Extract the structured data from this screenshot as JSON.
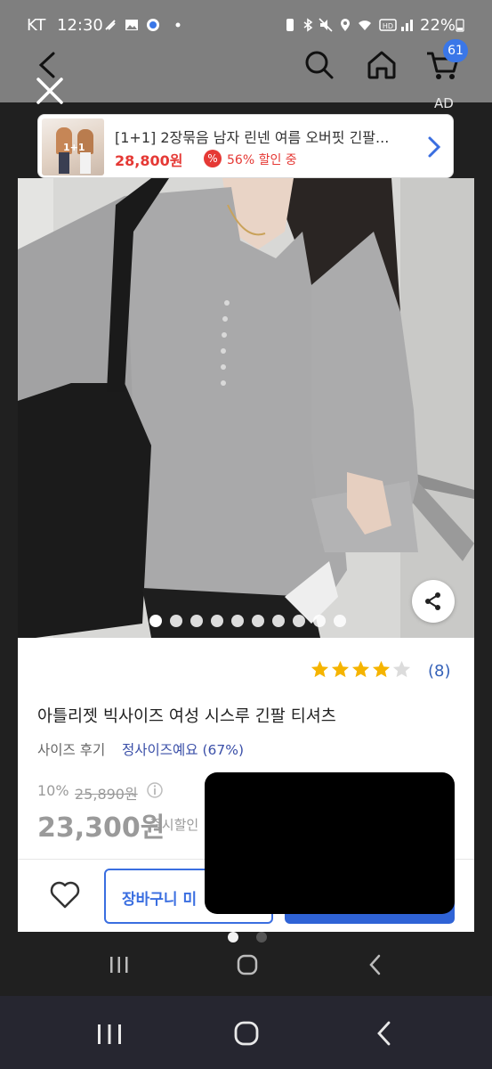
{
  "status_bar": {
    "carrier": "KT",
    "time": "12:30",
    "battery_percent": "22%"
  },
  "header": {
    "cart_count": "61",
    "ad_label": "AD"
  },
  "ad_banner": {
    "thumb_badge": "1+1",
    "title": "[1+1] 2장묶음 남자 린넨 여름 오버핏 긴팔...",
    "price": "28,800원",
    "sale_icon": "%",
    "discount": "56% 할인 중"
  },
  "product": {
    "rating": 4,
    "rating_max": 5,
    "review_count": "(8)",
    "title": "아틀리젯 빅사이즈 여성 시스루 긴팔 티셔츠",
    "size_review_label": "사이즈 후기",
    "size_review_value": "정사이즈예요 (67%)",
    "discount_rate": "10%",
    "original_price": "25,890원",
    "sale_price": "23,300원",
    "instant_discount_label": "즉시할인",
    "image_count": 10,
    "current_image_index": 0
  },
  "action_bar": {
    "add_to_cart_label": "장바구니 미"
  },
  "colors": {
    "accent": "#3a6ee0",
    "sale_red": "#e53935",
    "star_gold": "#f5b400",
    "link_blue": "#3461b8"
  },
  "icons": {
    "back": "chevron-left-icon",
    "search": "search-icon",
    "home": "home-icon",
    "cart": "cart-icon",
    "close": "close-icon",
    "share": "share-icon",
    "wishlist": "heart-icon",
    "info": "info-icon"
  }
}
